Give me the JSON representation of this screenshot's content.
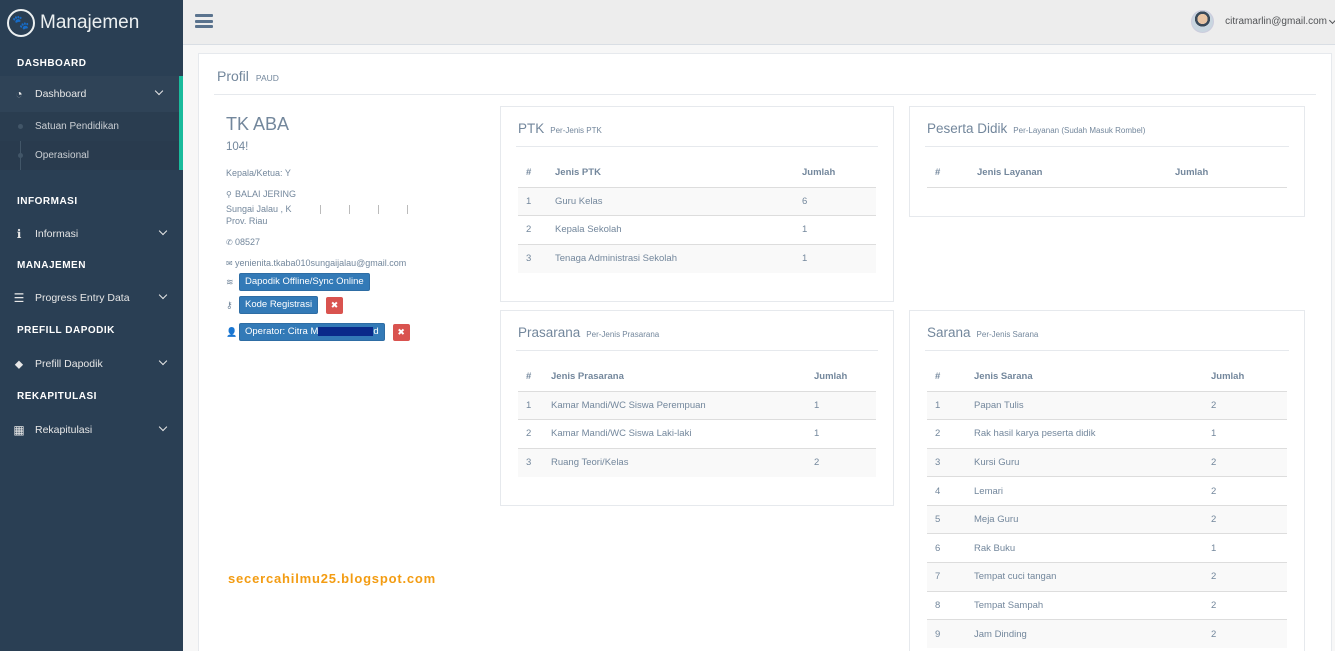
{
  "brand": {
    "title": "Manajemen",
    "icon": "paw-icon"
  },
  "sidebar": {
    "sections": [
      {
        "title": "DASHBOARD",
        "items": [
          {
            "label": "Dashboard",
            "icon": "dashboard-icon"
          }
        ],
        "submenu": [
          "Satuan Pendidikan",
          "Operasional"
        ]
      },
      {
        "title": "INFORMASI",
        "items": [
          {
            "label": "Informasi",
            "icon": "info-icon"
          }
        ]
      },
      {
        "title": "MANAJEMEN",
        "items": [
          {
            "label": "Progress Entry Data",
            "icon": "list-icon"
          }
        ]
      },
      {
        "title": "PREFILL DAPODIK",
        "items": [
          {
            "label": "Prefill Dapodik",
            "icon": "tags-icon"
          }
        ]
      },
      {
        "title": "REKAPITULASI",
        "items": [
          {
            "label": "Rekapitulasi",
            "icon": "table-icon"
          }
        ]
      }
    ]
  },
  "topbar": {
    "user_email": "citramarlin@gmail.com"
  },
  "page": {
    "title": "Profil",
    "subtitle": "PAUD"
  },
  "profile": {
    "name": "TK ABA",
    "npsn": "104!",
    "kepala": "Kepala/Ketua: Y",
    "address1": "BALAI JERING",
    "address2": "Sungai Jalau , K",
    "address3": "Prov. Riau",
    "phone": "08527",
    "email": "yenienita.tkaba010sungaijalau@gmail.com",
    "sync_label": "Dapodik Offline/Sync Online",
    "kode_label": "Kode Registrasi",
    "operator_label": "Operator: Citra M",
    "operator_suffix": "d"
  },
  "watermark": "secercahilmu25.blogspot.com",
  "ptk": {
    "title": "PTK",
    "subtitle": "Per-Jenis PTK",
    "headers": [
      "#",
      "Jenis PTK",
      "Jumlah"
    ],
    "rows": [
      [
        "1",
        "Guru Kelas",
        "6"
      ],
      [
        "2",
        "Kepala Sekolah",
        "1"
      ],
      [
        "3",
        "Tenaga Administrasi Sekolah",
        "1"
      ]
    ]
  },
  "peserta": {
    "title": "Peserta Didik",
    "subtitle": "Per-Layanan (Sudah Masuk Rombel)",
    "headers": [
      "#",
      "Jenis Layanan",
      "Jumlah"
    ],
    "rows": []
  },
  "prasarana": {
    "title": "Prasarana",
    "subtitle": "Per-Jenis Prasarana",
    "headers": [
      "#",
      "Jenis Prasarana",
      "Jumlah"
    ],
    "rows": [
      [
        "1",
        "Kamar Mandi/WC Siswa Perempuan",
        "1"
      ],
      [
        "2",
        "Kamar Mandi/WC Siswa Laki-laki",
        "1"
      ],
      [
        "3",
        "Ruang Teori/Kelas",
        "2"
      ]
    ]
  },
  "sarana": {
    "title": "Sarana",
    "subtitle": "Per-Jenis Sarana",
    "headers": [
      "#",
      "Jenis Sarana",
      "Jumlah"
    ],
    "rows": [
      [
        "1",
        "Papan Tulis",
        "2"
      ],
      [
        "2",
        "Rak hasil karya peserta didik",
        "1"
      ],
      [
        "3",
        "Kursi Guru",
        "2"
      ],
      [
        "4",
        "Lemari",
        "2"
      ],
      [
        "5",
        "Meja Guru",
        "2"
      ],
      [
        "6",
        "Rak Buku",
        "1"
      ],
      [
        "7",
        "Tempat cuci tangan",
        "2"
      ],
      [
        "8",
        "Tempat Sampah",
        "2"
      ],
      [
        "9",
        "Jam Dinding",
        "2"
      ]
    ]
  }
}
